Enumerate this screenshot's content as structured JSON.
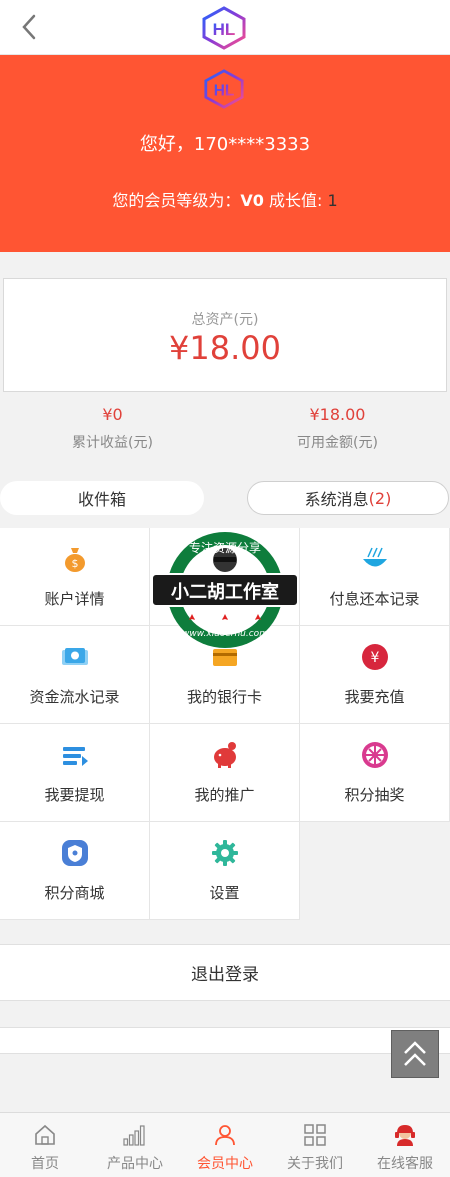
{
  "header": {
    "logo": "HL"
  },
  "hero": {
    "logo": "HL",
    "greeting": "您好，170****3333",
    "level_prefix": "您的会员等级为：",
    "level_value": "V0",
    "growth_label": " 成长值: ",
    "growth_value": "1"
  },
  "assets": {
    "label": "总资产(元)",
    "value": "¥18.00"
  },
  "stats": [
    {
      "value": "¥0",
      "label": "累计收益(元)"
    },
    {
      "value": "¥18.00",
      "label": "可用金额(元)"
    }
  ],
  "tabs": {
    "inbox": "收件箱",
    "system": "系统消息",
    "system_count": "(2)"
  },
  "menu": [
    {
      "label": "账户详情",
      "icon": "money-bag-icon",
      "color": "#f39a2d"
    },
    {
      "label": "",
      "icon": "",
      "color": ""
    },
    {
      "label": "付息还本记录",
      "icon": "bowl-icon",
      "color": "#1fa6e0"
    },
    {
      "label": "资金流水记录",
      "icon": "cash-icon",
      "color": "#3aa7e8"
    },
    {
      "label": "我的银行卡",
      "icon": "bank-card-icon",
      "color": "#f5a623"
    },
    {
      "label": "我要充值",
      "icon": "yen-icon",
      "color": "#d7263d"
    },
    {
      "label": "我要提现",
      "icon": "withdraw-icon",
      "color": "#2d8fe0"
    },
    {
      "label": "我的推广",
      "icon": "piggy-bank-icon",
      "color": "#e03a3a"
    },
    {
      "label": "积分抽奖",
      "icon": "lottery-wheel-icon",
      "color": "#d93a8f"
    },
    {
      "label": "积分商城",
      "icon": "shield-icon",
      "color": "#4a7fd6"
    },
    {
      "label": "设置",
      "icon": "gear-icon",
      "color": "#2fb79a"
    }
  ],
  "logout_label": "退出登录",
  "watermark": {
    "top_text": "专注资源分享",
    "banner_text": "小二胡工作室",
    "url_text": "www.xiaoerhu.com"
  },
  "bottom_nav": [
    {
      "label": "首页",
      "icon": "home-icon"
    },
    {
      "label": "产品中心",
      "icon": "signal-bars-icon"
    },
    {
      "label": "会员中心",
      "icon": "user-icon",
      "active": true
    },
    {
      "label": "关于我们",
      "icon": "grid-icon"
    },
    {
      "label": "在线客服",
      "icon": "customer-service-icon"
    }
  ],
  "colors": {
    "accent": "#ff5533",
    "price": "#e0413a"
  }
}
